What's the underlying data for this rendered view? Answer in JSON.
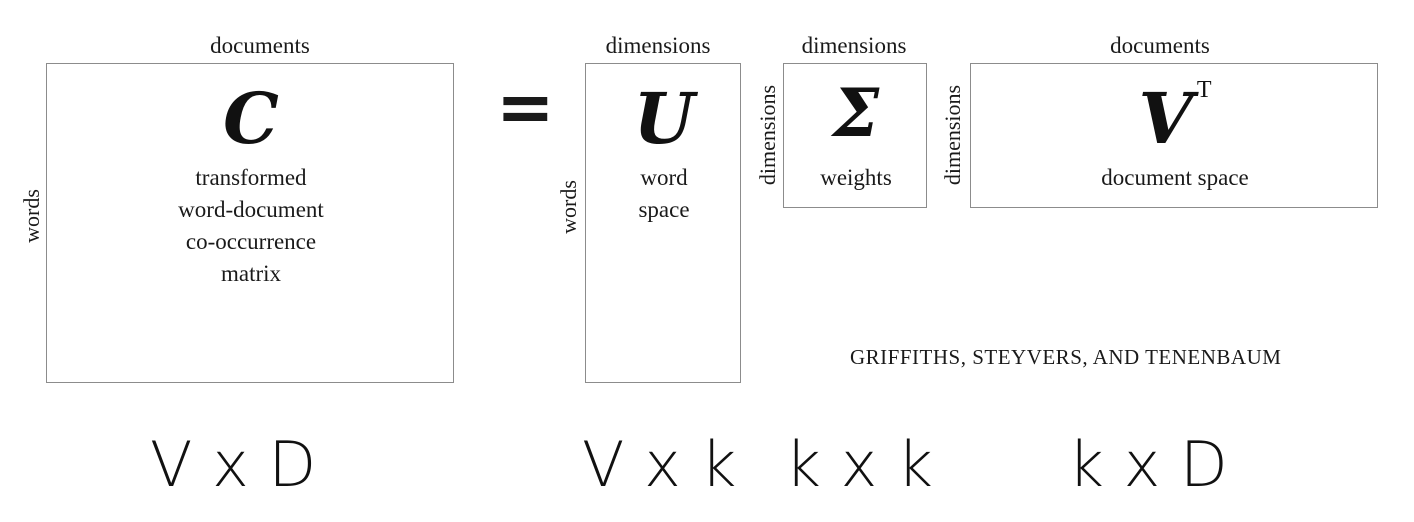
{
  "matrix_c": {
    "top_label": "documents",
    "side_label": "words",
    "symbol": "C",
    "description": [
      "transformed",
      "word-document",
      "co-occurrence",
      "matrix"
    ]
  },
  "equals": "=",
  "matrix_u": {
    "top_label": "dimensions",
    "side_label": "words",
    "symbol": "U",
    "description": [
      "word",
      "space"
    ]
  },
  "matrix_sigma": {
    "top_label": "dimensions",
    "side_label": "dimensions",
    "symbol": "Σ",
    "description": [
      "weights"
    ]
  },
  "matrix_v": {
    "top_label": "documents",
    "side_label": "dimensions",
    "symbol": "V",
    "superscript": "T",
    "description": [
      "document space"
    ]
  },
  "credit": "GRIFFITHS, STEYVERS, AND TENENBAUM",
  "dimension_labels": {
    "c": "V x D",
    "u": "V x k",
    "sigma": "k x k",
    "v": "k x D"
  }
}
